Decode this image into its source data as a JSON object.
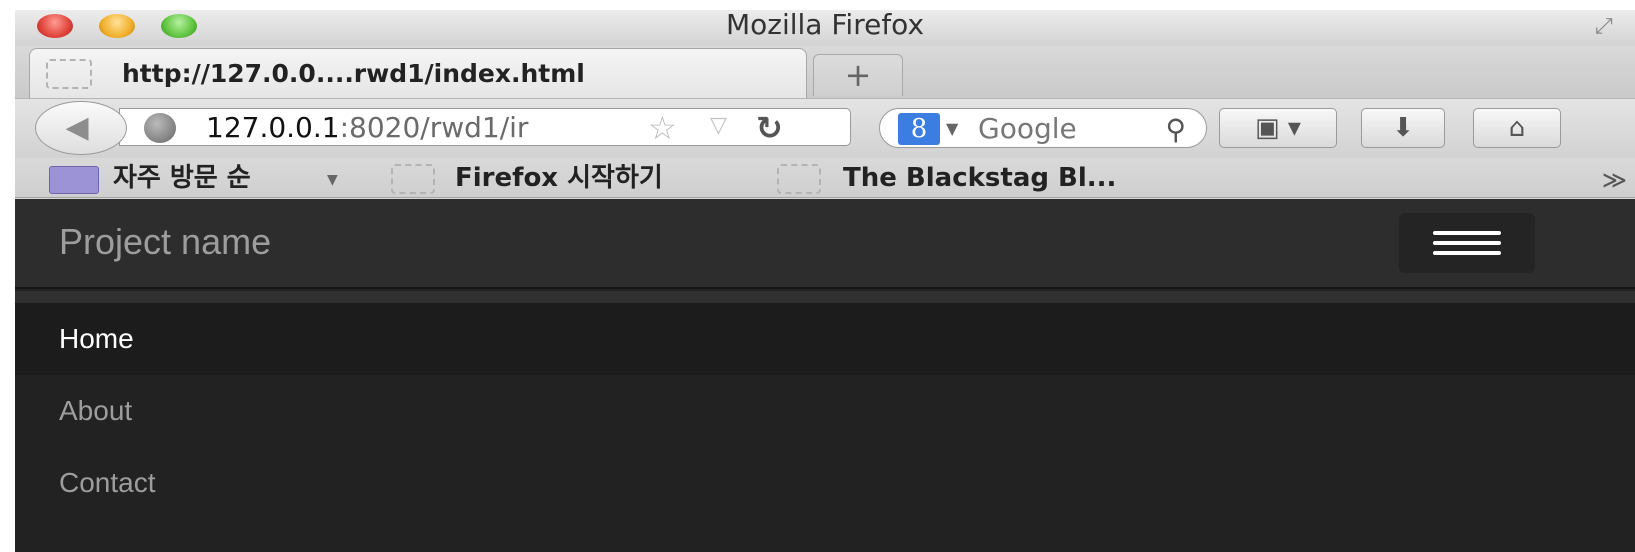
{
  "window": {
    "title": "Mozilla Firefox"
  },
  "tabs": [
    {
      "label": "http://127.0.0....rwd1/index.html"
    }
  ],
  "new_tab_label": "+",
  "urlbar": {
    "host": "127.0.0.1",
    "rest": ":8020/rwd1/ir"
  },
  "search": {
    "engine": "Google",
    "badge": "8"
  },
  "bookmarks_bar": {
    "folder_label": "자주 방문 순",
    "items": [
      {
        "label": "Firefox 시작하기"
      },
      {
        "label": "The Blackstag Bl..."
      }
    ],
    "more": "≫"
  },
  "site": {
    "brand": "Project name",
    "nav": [
      {
        "label": "Home",
        "active": true
      },
      {
        "label": "About",
        "active": false
      },
      {
        "label": "Contact",
        "active": false
      }
    ]
  },
  "colors": {
    "navbar_bg": "#2d2d2d",
    "page_bg": "#222222",
    "active_item_bg": "#1c1c1c",
    "muted_text": "#9d9d9d"
  }
}
